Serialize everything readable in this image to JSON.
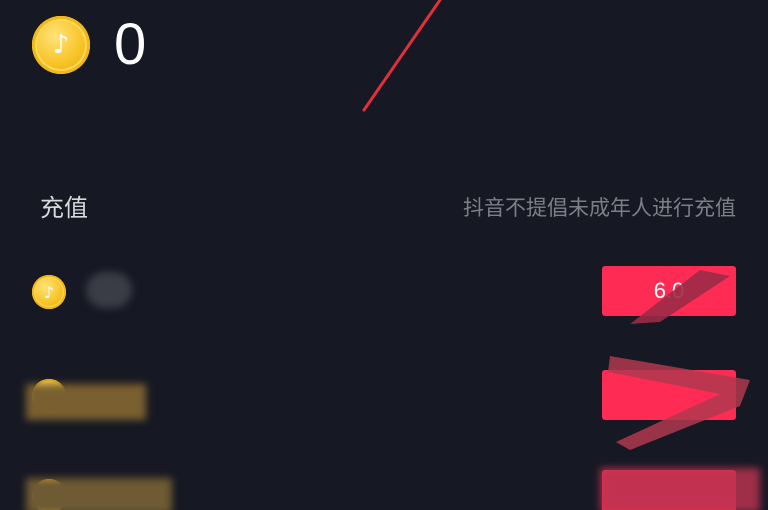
{
  "balance": {
    "coin_icon": "douyin-coin-icon",
    "coin_glyph": "♪",
    "value": "0"
  },
  "recharge": {
    "title": "充值",
    "notice": "抖音不提倡未成年人进行充值",
    "options": [
      {
        "coin_glyph": "♪",
        "amount": "",
        "price": "6.0"
      },
      {
        "coin_glyph": "♪",
        "amount": "",
        "price": ""
      },
      {
        "coin_glyph": "♪",
        "amount": "",
        "price": ""
      }
    ]
  },
  "colors": {
    "background": "#161823",
    "accent": "#fe2c55",
    "coin": "#f7c325",
    "annotation": "#e0303a"
  }
}
